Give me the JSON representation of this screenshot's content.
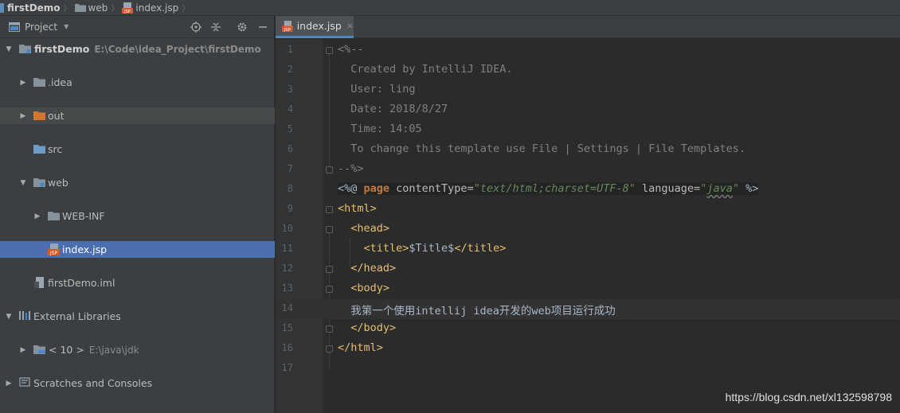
{
  "breadcrumb": [
    {
      "label": "firstDemo",
      "icon": "module-icon",
      "bold": true
    },
    {
      "label": "web",
      "icon": "folder-icon",
      "bold": false
    },
    {
      "label": "index.jsp",
      "icon": "jsp-file-icon",
      "bold": false
    }
  ],
  "panel": {
    "title": "Project",
    "caret": "▼"
  },
  "tree": [
    {
      "label": "firstDemo",
      "path": "E:\\Code\\idea_Project\\firstDemo"
    },
    {
      "label": ".idea"
    },
    {
      "label": "out"
    },
    {
      "label": "src"
    },
    {
      "label": "web"
    },
    {
      "label": "WEB-INF"
    },
    {
      "label": "index.jsp"
    },
    {
      "label": "firstDemo.iml"
    },
    {
      "label": "External Libraries"
    },
    {
      "label": "< 10 >",
      "path": "E:\\java\\jdk"
    },
    {
      "label": "Scratches and Consoles"
    }
  ],
  "editor_tab": {
    "label": "index.jsp",
    "close": "×"
  },
  "code_lines": [
    "1",
    "2",
    "3",
    "4",
    "5",
    "6",
    "7",
    "8",
    "9",
    "10",
    "11",
    "12",
    "13",
    "14",
    "15",
    "16",
    "17"
  ],
  "code": {
    "l1": "<%--",
    "l2": "  Created by IntelliJ IDEA.",
    "l3": "  User: ling",
    "l4": "  Date: 2018/8/27",
    "l5": "  Time: 14:05",
    "l6": "  To change this template use File | Settings | File Templates.",
    "l7": "--%>",
    "l8_open": "<%@ ",
    "l8_dir": "page",
    "l8_attr1": " contentType=",
    "l8_val1": "\"text/html;charset=UTF-8\"",
    "l8_attr2": " language=",
    "l8_val2_q1": "\"",
    "l8_val2": "java",
    "l8_val2_q2": "\"",
    "l8_close": " %>",
    "l9": "<html>",
    "l10": "  <head>",
    "l11_open": "    <title>",
    "l11_text": "$Title$",
    "l11_close": "</title>",
    "l12": "  </head>",
    "l13": "  <body>",
    "l14": "  我第一个使用intellij idea开发的web项目运行成功",
    "l15": "  </body>",
    "l16": "</html>",
    "l17": ""
  },
  "watermark": "https://blog.csdn.net/xl132598798",
  "colors": {
    "accent": "#4b6eaf",
    "tag": "#e8bf6a",
    "keyword": "#cc7832",
    "string": "#6a8759",
    "comment": "#808080"
  }
}
